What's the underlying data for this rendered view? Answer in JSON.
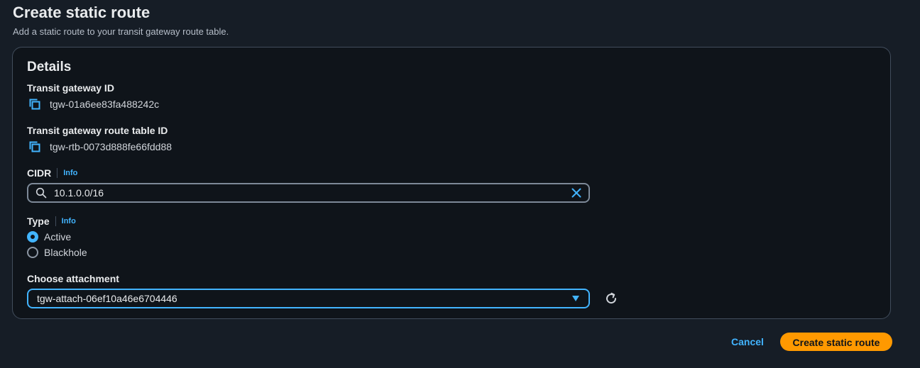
{
  "header": {
    "title": "Create static route",
    "description": "Add a static route to your transit gateway route table."
  },
  "details": {
    "title": "Details",
    "transit_gateway_id": {
      "label": "Transit gateway ID",
      "value": "tgw-01a6ee83fa488242c"
    },
    "route_table_id": {
      "label": "Transit gateway route table ID",
      "value": "tgw-rtb-0073d888fe66fdd88"
    },
    "cidr": {
      "label": "CIDR",
      "info": "Info",
      "value": "10.1.0.0/16"
    },
    "type": {
      "label": "Type",
      "info": "Info",
      "options": [
        {
          "label": "Active",
          "checked": true
        },
        {
          "label": "Blackhole",
          "checked": false
        }
      ]
    },
    "attachment": {
      "label": "Choose attachment",
      "selected": "tgw-attach-06ef10a46e6704446"
    }
  },
  "actions": {
    "cancel_label": "Cancel",
    "submit_label": "Create static route"
  },
  "colors": {
    "accent": "#42b4ff",
    "primary_button": "#ff9900",
    "background": "#161d26",
    "panel": "#0f141a"
  },
  "icons": {
    "copy": "copy-icon",
    "search": "search-icon",
    "clear": "close-icon",
    "caret": "caret-down-icon",
    "refresh": "refresh-icon"
  }
}
